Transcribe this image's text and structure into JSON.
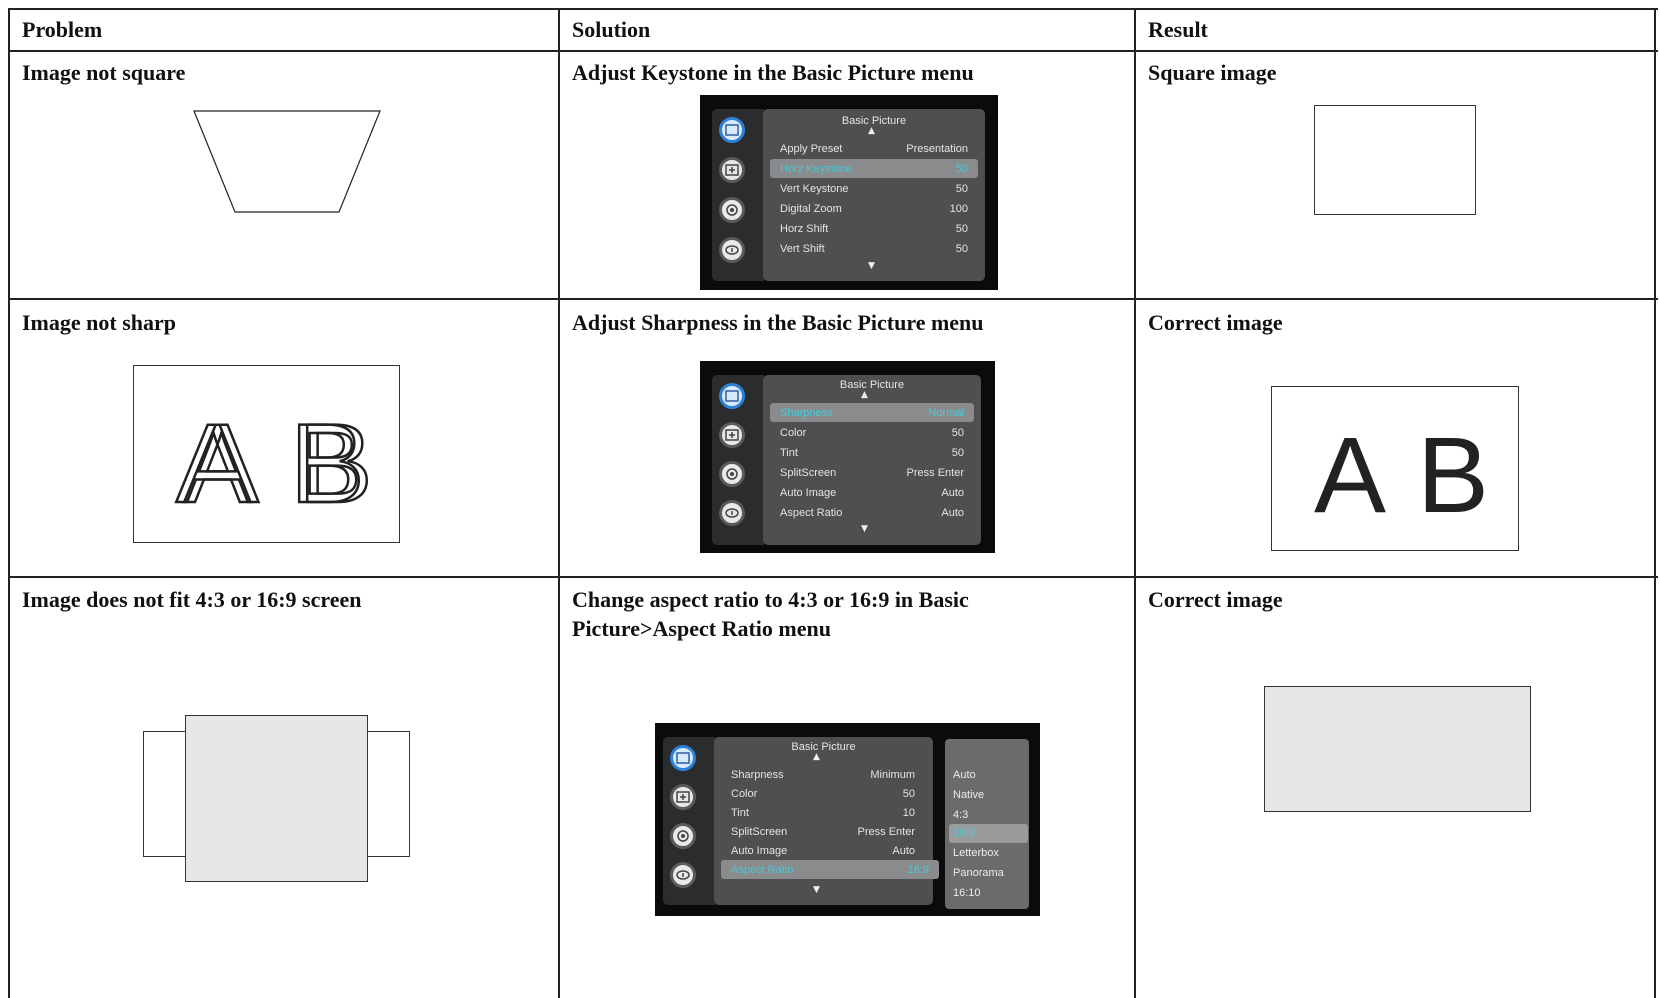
{
  "table": {
    "headers": [
      "Problem",
      "Solution",
      "Result"
    ],
    "rows": [
      {
        "problem": "Image not square",
        "solution": "Adjust Keystone in the Basic Picture menu",
        "result": "Square image",
        "menu": {
          "title": "Basic Picture",
          "items": [
            {
              "label": "Apply Preset",
              "value": "Presentation"
            },
            {
              "label": "Horz Keystone",
              "value": "50"
            },
            {
              "label": "Vert Keystone",
              "value": "50"
            },
            {
              "label": "Digital Zoom",
              "value": "100"
            },
            {
              "label": "Horz Shift",
              "value": "50"
            },
            {
              "label": "Vert Shift",
              "value": "50"
            }
          ]
        }
      },
      {
        "problem": "Image not sharp",
        "solution": "Adjust Sharpness in the Basic Picture menu",
        "result": "Correct image",
        "letters_blurry": [
          "A",
          "B"
        ],
        "letters_sharp": [
          "A",
          "B"
        ],
        "menu": {
          "title": "Basic Picture",
          "items": [
            {
              "label": "Sharpness",
              "value": "Normal"
            },
            {
              "label": "Color",
              "value": "50"
            },
            {
              "label": "Tint",
              "value": "50"
            },
            {
              "label": "SplitScreen",
              "value": "Press Enter"
            },
            {
              "label": "Auto Image",
              "value": "Auto"
            },
            {
              "label": "Aspect Ratio",
              "value": "Auto"
            }
          ]
        }
      },
      {
        "problem": "Image does not fit 4:3 or 16:9 screen",
        "solution_line1": "Change aspect ratio to 4:3 or 16:9 in Basic",
        "solution_line2": "Picture>Aspect Ratio menu",
        "result": "Correct image",
        "menu": {
          "title": "Basic Picture",
          "items": [
            {
              "label": "Sharpness",
              "value": "Minimum"
            },
            {
              "label": "Color",
              "value": "50"
            },
            {
              "label": "Tint",
              "value": "10"
            },
            {
              "label": "SplitScreen",
              "value": "Press Enter"
            },
            {
              "label": "Auto Image",
              "value": "Auto"
            },
            {
              "label": "Aspect Ratio",
              "value": "16:9"
            }
          ],
          "submenu": [
            "Auto",
            "Native",
            "4:3",
            "16:9",
            "Letterbox",
            "Panorama",
            "16:10"
          ]
        }
      }
    ]
  },
  "colors": {
    "menu_bg": "#0b0b0b",
    "panel": "#4d4f51",
    "highlight_text": "#49c9d4",
    "fill_gray": "#e6e6e6"
  }
}
